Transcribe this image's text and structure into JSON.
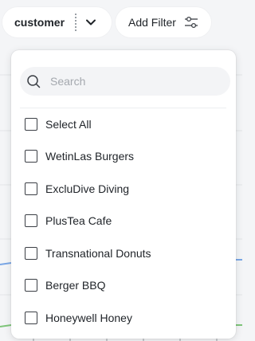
{
  "filters": {
    "customer_pill": {
      "label": "customer",
      "chevron_icon": "chevron-down-icon"
    },
    "add_filter": {
      "label": "Add Filter",
      "icon": "sliders-icon"
    }
  },
  "dropdown": {
    "search": {
      "placeholder": "Search",
      "value": "",
      "icon": "search-icon"
    },
    "options": [
      {
        "label": "Select All",
        "checked": false
      },
      {
        "label": "WetinLas Burgers",
        "checked": false
      },
      {
        "label": "ExcluDive Diving",
        "checked": false
      },
      {
        "label": "PlusTea Cafe",
        "checked": false
      },
      {
        "label": "Transnational Donuts",
        "checked": false
      },
      {
        "label": "Berger BBQ",
        "checked": false
      },
      {
        "label": "Honeywell Honey",
        "checked": false
      }
    ]
  },
  "colors": {
    "page_background": "#f4f5f7",
    "panel_background": "#ffffff",
    "search_background": "#f3f4f6",
    "line_blue": "#7aa7e6",
    "line_green": "#7fc67a"
  }
}
